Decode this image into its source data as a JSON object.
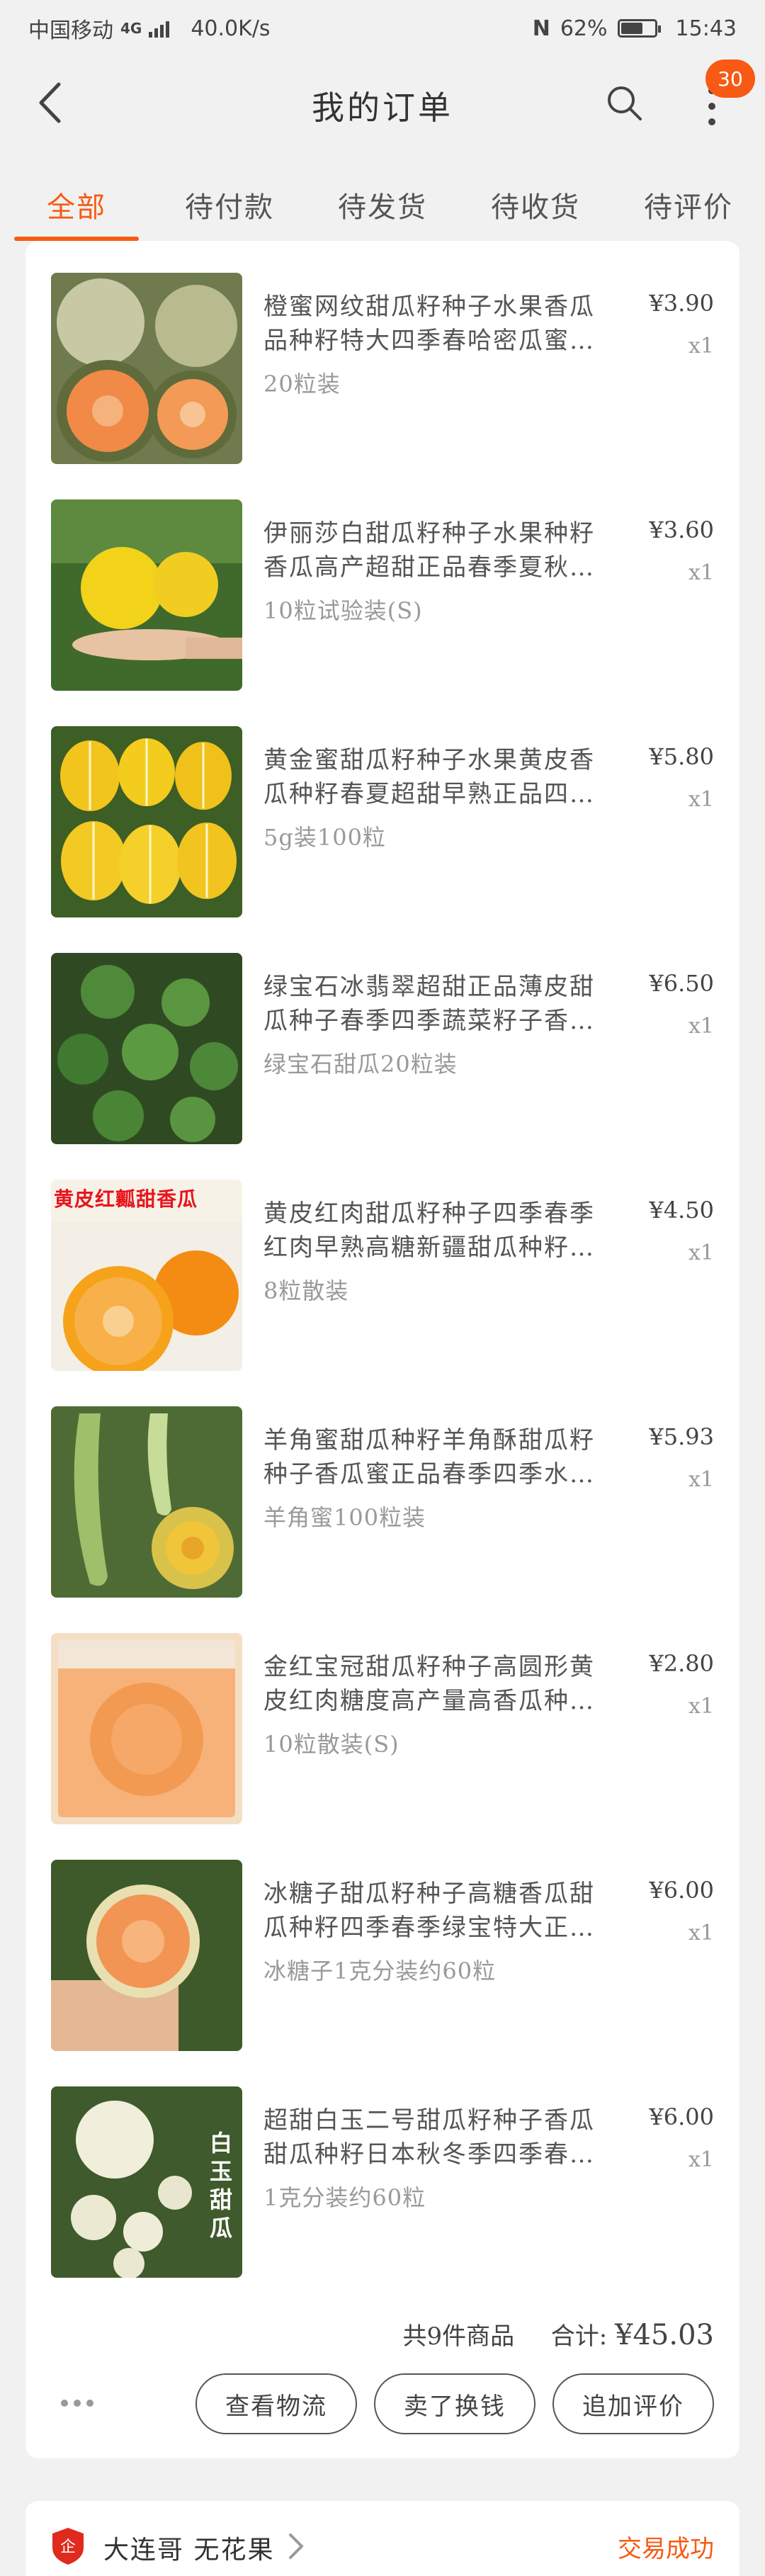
{
  "status_bar": {
    "carrier": "中国移动",
    "network": "4G",
    "speed": "40.0K/s",
    "nfc": "N",
    "battery": "62%",
    "battery_level": 0.62,
    "time": "15:43"
  },
  "header": {
    "title": "我的订单",
    "badge_count": "30"
  },
  "tabs": [
    {
      "label": "全部",
      "active": true
    },
    {
      "label": "待付款",
      "active": false
    },
    {
      "label": "待发货",
      "active": false
    },
    {
      "label": "待收货",
      "active": false
    },
    {
      "label": "待评价",
      "active": false
    }
  ],
  "order": {
    "items": [
      {
        "title": "橙蜜网纹甜瓜籽种子水果香瓜品种籽特大四季春哈密瓜蜜子新…",
        "spec": "20粒装",
        "price": "¥3.90",
        "qty": "x1",
        "image": "netted-cantaloupe"
      },
      {
        "title": "伊丽莎白甜瓜籽种子水果种籽香瓜高产超甜正品春季夏秋四季盆…",
        "spec": "10粒试验装(S)",
        "price": "¥3.60",
        "qty": "x1",
        "image": "yellow-melon"
      },
      {
        "title": "黄金蜜甜瓜籽种子水果黄皮香瓜种籽春夏超甜早熟正品四季春季…",
        "spec": "5g装100粒",
        "price": "¥5.80",
        "qty": "x1",
        "image": "striped-golden-melon"
      },
      {
        "title": "绿宝石冰翡翠超甜正品薄皮甜瓜种子春季四季蔬菜籽子香瓜种籽…",
        "spec": "绿宝石甜瓜20粒装",
        "price": "¥6.50",
        "qty": "x1",
        "image": "green-melon"
      },
      {
        "title": "黄皮红肉甜瓜籽种子四季春季红肉早熟高糖新疆甜瓜种籽正品盆…",
        "spec": "8粒散装",
        "price": "¥4.50",
        "qty": "x1",
        "image": "orange-melon",
        "image_text": "黄皮红瓤甜香瓜"
      },
      {
        "title": "羊角蜜甜瓜种籽羊角酥甜瓜籽种子香瓜蜜正品春季四季水果特大…",
        "spec": "羊角蜜100粒装",
        "price": "¥5.93",
        "qty": "x1",
        "image": "horn-melon"
      },
      {
        "title": "金红宝冠甜瓜籽种子高圆形黄皮红肉糖度高产量高香瓜种籽中早熟…",
        "spec": "10粒散装(S)",
        "price": "¥2.80",
        "qty": "x1",
        "image": "seed-packet"
      },
      {
        "title": "冰糖子甜瓜籽种子高糖香瓜甜瓜种籽四季春季绿宝特大正品早熟…",
        "spec": "冰糖子1克分装约60粒",
        "price": "¥6.00",
        "qty": "x1",
        "image": "cut-melon"
      },
      {
        "title": "超甜白玉二号甜瓜籽种子香瓜甜瓜种籽日本秋冬季四季春季…",
        "spec": "1克分装约60粒",
        "price": "¥6.00",
        "qty": "x1",
        "image": "white-jade-melon",
        "image_text": "白玉甜瓜"
      }
    ],
    "summary_count": "共9件商品",
    "summary_total_label": "合计:",
    "summary_total": "¥45.03",
    "actions": [
      "查看物流",
      "卖了换钱",
      "追加评价"
    ]
  },
  "next_shop": {
    "name": "大连哥 无花果",
    "status": "交易成功"
  },
  "colors": {
    "accent": "#f85a13",
    "background": "#f1f1f1",
    "card": "#ffffff"
  }
}
